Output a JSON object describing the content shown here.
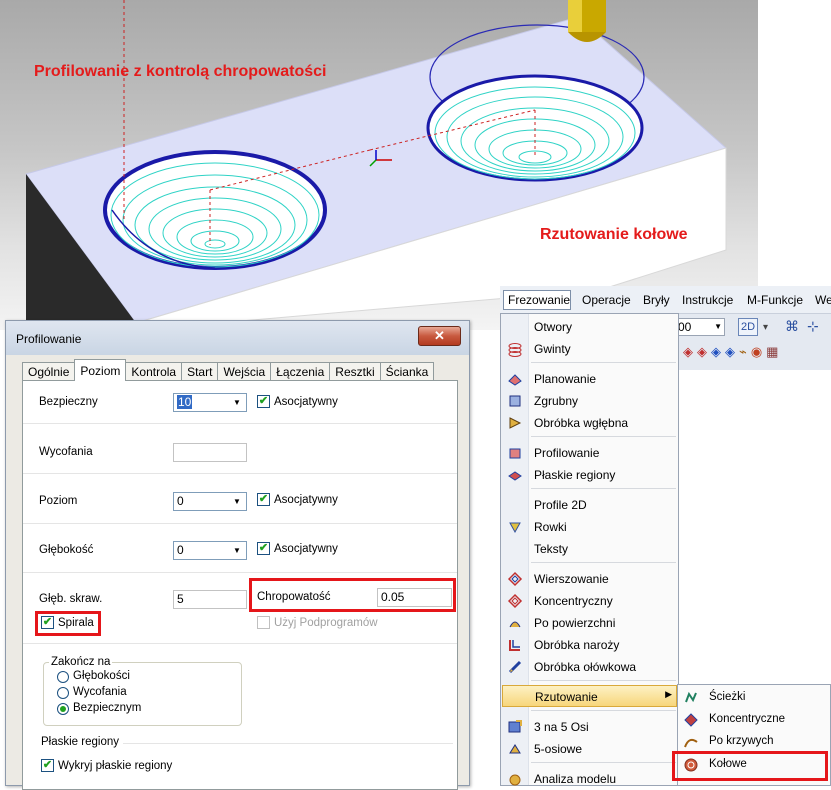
{
  "viewport": {
    "caption_left": "Profilowanie z kontrolą chropowatości",
    "caption_right": "Rzutowanie kołowe"
  },
  "dialog": {
    "title": "Profilowanie",
    "close_label": "✕",
    "tabs": [
      "Ogólnie",
      "Poziom",
      "Kontrola",
      "Start",
      "Wejścia",
      "Łączenia",
      "Resztki",
      "Ścianka"
    ],
    "active_tab": "Poziom",
    "fields": {
      "bezpieczny_label": "Bezpieczny",
      "bezpieczny_value": "10",
      "asoc_label": "Asocjatywny",
      "wycofania_label": "Wycofania",
      "poziom_label": "Poziom",
      "poziom_value": "0",
      "glebokosc_label": "Głębokość",
      "glebokosc_value": "0",
      "gleb_skraw_label": "Głęb. skraw.",
      "gleb_skraw_value": "5",
      "chropowatosc_label": "Chropowatość",
      "chropowatosc_value": "0.05",
      "spirala_label": "Spirala",
      "uzyj_label": "Użyj Podprogramów",
      "zakoncz_label": "Zakończ na",
      "zakoncz_options": [
        "Głębokości",
        "Wycofania",
        "Bezpiecznym"
      ],
      "zakoncz_selected": "Bezpiecznym",
      "plaskie_label": "Płaskie regiony",
      "wykryj_label": "Wykryj płaskie regiony"
    }
  },
  "menubar": {
    "items": [
      "Frezowanie",
      "Operacje",
      "Bryły",
      "Instrukcje",
      "M-Funkcje",
      "We"
    ]
  },
  "toolbar": {
    "combo_value": "00",
    "btn_2d": "2D"
  },
  "menu": {
    "items": [
      {
        "label": "Otwory",
        "icon": "drill-icon"
      },
      {
        "label": "Gwinty",
        "icon": "thread-icon"
      },
      {
        "label": "Planowanie",
        "icon": "facing-icon"
      },
      {
        "label": "Zgrubny",
        "icon": "roughing-icon"
      },
      {
        "label": "Obróbka wgłębna",
        "icon": "plunge-icon"
      },
      {
        "label": "Profilowanie",
        "icon": "profiling-icon"
      },
      {
        "label": "Płaskie regiony",
        "icon": "flat-regions-icon"
      },
      {
        "label": "Profile 2D",
        "icon": ""
      },
      {
        "label": "Rowki",
        "icon": "slots-icon"
      },
      {
        "label": "Teksty",
        "icon": ""
      },
      {
        "label": "Wierszowanie",
        "icon": "raster-icon"
      },
      {
        "label": "Koncentryczny",
        "icon": "concentric-icon"
      },
      {
        "label": "Po powierzchni",
        "icon": "surface-icon"
      },
      {
        "label": "Obróbka naroży",
        "icon": "corner-icon"
      },
      {
        "label": "Obróbka ołówkowa",
        "icon": "pencil-icon"
      },
      {
        "label": "Rzutowanie",
        "icon": ""
      },
      {
        "label": "3 na 5 Osi",
        "icon": "3to5-axis-icon"
      },
      {
        "label": "5-osiowe",
        "icon": "5-axis-icon"
      },
      {
        "label": "Analiza modelu",
        "icon": "analysis-icon"
      }
    ],
    "submenu": [
      {
        "label": "Ścieżki",
        "icon": "paths-icon"
      },
      {
        "label": "Koncentryczne",
        "icon": "concentric-icon"
      },
      {
        "label": "Po krzywych",
        "icon": "curves-icon"
      },
      {
        "label": "Kołowe",
        "icon": "circular-icon"
      }
    ]
  },
  "colors": {
    "highlight_red": "#e5161a",
    "caption_red": "#e41b1b",
    "toolpath_cyan": "#2fd3c6",
    "pocket_blue": "#1a1aa8"
  }
}
